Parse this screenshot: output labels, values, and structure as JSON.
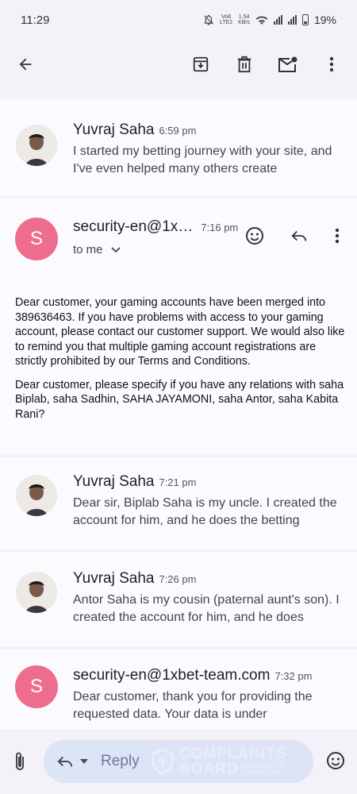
{
  "status_bar": {
    "time": "11:29",
    "volte_top": "Vo8",
    "volte_bottom": "LTE2",
    "speed_top": "1.54",
    "speed_bottom": "KB/s",
    "battery": "19%"
  },
  "toolbar": {
    "back_icon": "arrow-left-icon",
    "archive_icon": "archive-icon",
    "delete_icon": "trash-icon",
    "mark_unread_icon": "mail-unread-icon",
    "more_icon": "more-vert-icon"
  },
  "messages": [
    {
      "sender": "Yuvraj Saha",
      "time": "6:59 pm",
      "preview": "I started my betting journey with your site, and I've even helped many others create"
    },
    {
      "sender": "security-en@1x…",
      "time": "7:16 pm",
      "avatar_letter": "S",
      "recipient": "to me",
      "body_p1": "Dear customer, your gaming accounts have been merged into 389636463. If you have problems with access to your gaming account, please contact our customer support. We would also like to remind you that multiple gaming account registrations are strictly prohibited by our Terms and Conditions.",
      "body_p2": "Dear customer, please specify if you have any relations with saha Biplab, saha Sadhin, SAHA JAYAMONI, saha Antor, saha Kabita Rani?"
    },
    {
      "sender": "Yuvraj Saha",
      "time": "7:21 pm",
      "preview": "Dear sir, Biplab Saha is my uncle. I created the account for him, and he does the betting"
    },
    {
      "sender": "Yuvraj Saha",
      "time": "7:26 pm",
      "preview": "Antor Saha is my cousin (paternal aunt's son). I created the account for him, and he does"
    },
    {
      "sender": "security-en@1xbet-team.com",
      "time": "7:32 pm",
      "avatar_letter": "S",
      "preview": "Dear customer, thank you for providing the requested data. Your data is under"
    }
  ],
  "bottom_bar": {
    "reply_label": "Reply",
    "watermark_line1": "COMPLAINTS",
    "watermark_line2": "BOARD",
    "watermark_sub1": "RESOLVE IT",
    "watermark_sub2": "SINCE 2011"
  },
  "colors": {
    "avatar_accent": "#ee6d8f",
    "background": "#f3f2f8",
    "reply_pill": "#dde4f6"
  }
}
